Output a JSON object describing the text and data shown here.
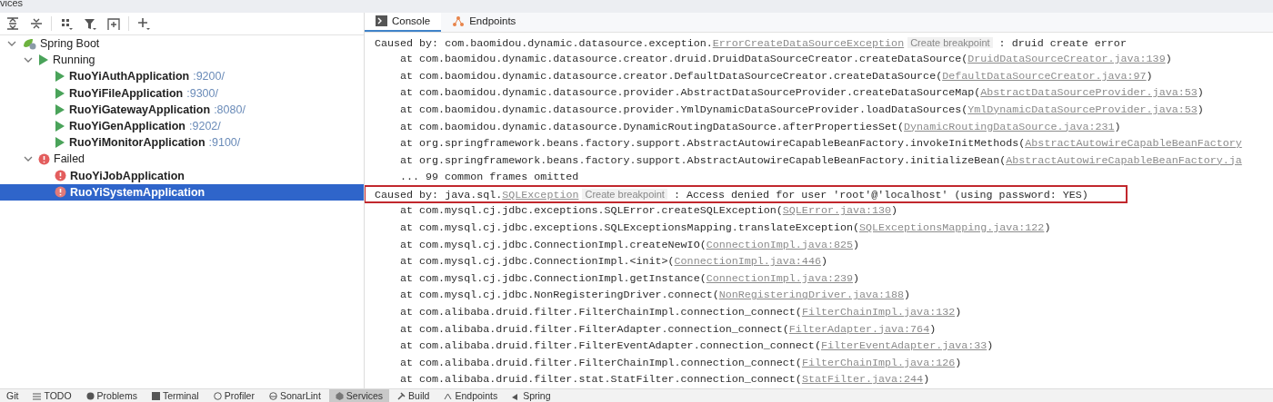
{
  "window": {
    "title": "vices"
  },
  "toolbar": {
    "buttons": [
      {
        "kind": "expand"
      },
      {
        "kind": "collapse"
      },
      {
        "kind": "group"
      },
      {
        "kind": "filter"
      },
      {
        "kind": "new-tab"
      },
      {
        "kind": "add"
      }
    ]
  },
  "tree": {
    "items": [
      {
        "label": "Spring Boot",
        "kind": "spring",
        "expanded": true,
        "selected": false,
        "children": [
          {
            "label": "Running",
            "kind": "running",
            "expanded": true,
            "selected": false,
            "children": [
              {
                "label": "RuoYiAuthApplication",
                "port": ":9200/",
                "kind": "running",
                "selected": false
              },
              {
                "label": "RuoYiFileApplication",
                "port": ":9300/",
                "kind": "running",
                "selected": false
              },
              {
                "label": "RuoYiGatewayApplication",
                "port": ":8080/",
                "kind": "running",
                "selected": false
              },
              {
                "label": "RuoYiGenApplication",
                "port": ":9202/",
                "kind": "running",
                "selected": false
              },
              {
                "label": "RuoYiMonitorApplication",
                "port": ":9100/",
                "kind": "running",
                "selected": false
              }
            ]
          },
          {
            "label": "Failed",
            "kind": "failed",
            "expanded": true,
            "selected": false,
            "children": [
              {
                "label": "RuoYiJobApplication",
                "kind": "failed",
                "selected": false
              },
              {
                "label": "RuoYiSystemApplication",
                "kind": "failed",
                "selected": true
              }
            ]
          }
        ]
      }
    ]
  },
  "tabs": [
    {
      "label": "Console",
      "kind": "console",
      "selected": true
    },
    {
      "label": "Endpoints",
      "kind": "endpoints",
      "selected": false
    }
  ],
  "console": {
    "lines": [
      {
        "kind": "cause",
        "highlighted": false,
        "parts": [
          {
            "kind": "plain",
            "text": "Caused by: com.baomidou.dynamic.datasource.exception."
          },
          {
            "kind": "link",
            "text": "ErrorCreateDataSourceException"
          },
          {
            "kind": "hint",
            "text": "Create breakpoint"
          },
          {
            "kind": "plain",
            "text": " : druid create error"
          }
        ]
      },
      {
        "kind": "frame",
        "highlighted": false,
        "parts": [
          {
            "kind": "plain",
            "text": "at com.baomidou.dynamic.datasource.creator.druid.DruidDataSourceCreator.createDataSource("
          },
          {
            "kind": "link",
            "text": "DruidDataSourceCreator.java:139"
          },
          {
            "kind": "plain",
            "text": ")"
          }
        ]
      },
      {
        "kind": "frame",
        "highlighted": false,
        "parts": [
          {
            "kind": "plain",
            "text": "at com.baomidou.dynamic.datasource.creator.DefaultDataSourceCreator.createDataSource("
          },
          {
            "kind": "link",
            "text": "DefaultDataSourceCreator.java:97"
          },
          {
            "kind": "plain",
            "text": ")"
          }
        ]
      },
      {
        "kind": "frame",
        "highlighted": false,
        "parts": [
          {
            "kind": "plain",
            "text": "at com.baomidou.dynamic.datasource.provider.AbstractDataSourceProvider.createDataSourceMap("
          },
          {
            "kind": "link",
            "text": "AbstractDataSourceProvider.java:53"
          },
          {
            "kind": "plain",
            "text": ")"
          }
        ]
      },
      {
        "kind": "frame",
        "highlighted": false,
        "parts": [
          {
            "kind": "plain",
            "text": "at com.baomidou.dynamic.datasource.provider.YmlDynamicDataSourceProvider.loadDataSources("
          },
          {
            "kind": "link",
            "text": "YmlDynamicDataSourceProvider.java:53"
          },
          {
            "kind": "plain",
            "text": ")"
          }
        ]
      },
      {
        "kind": "frame",
        "highlighted": false,
        "parts": [
          {
            "kind": "plain",
            "text": "at com.baomidou.dynamic.datasource.DynamicRoutingDataSource.afterPropertiesSet("
          },
          {
            "kind": "link",
            "text": "DynamicRoutingDataSource.java:231"
          },
          {
            "kind": "plain",
            "text": ")"
          }
        ]
      },
      {
        "kind": "frame",
        "highlighted": false,
        "parts": [
          {
            "kind": "plain",
            "text": "at org.springframework.beans.factory.support.AbstractAutowireCapableBeanFactory.invokeInitMethods("
          },
          {
            "kind": "link",
            "text": "AbstractAutowireCapableBeanFactory"
          }
        ]
      },
      {
        "kind": "frame",
        "highlighted": false,
        "parts": [
          {
            "kind": "plain",
            "text": "at org.springframework.beans.factory.support.AbstractAutowireCapableBeanFactory.initializeBean("
          },
          {
            "kind": "link",
            "text": "AbstractAutowireCapableBeanFactory.ja"
          }
        ]
      },
      {
        "kind": "frame",
        "highlighted": false,
        "parts": [
          {
            "kind": "plain",
            "text": "... 99 common frames omitted"
          }
        ]
      },
      {
        "kind": "cause",
        "highlighted": true,
        "parts": [
          {
            "kind": "plain",
            "text": "Caused by: java.sql."
          },
          {
            "kind": "link",
            "text": "SQLException"
          },
          {
            "kind": "hint",
            "text": "Create breakpoint"
          },
          {
            "kind": "plain",
            "text": " : Access denied for user 'root'@'localhost' (using password: YES)"
          }
        ]
      },
      {
        "kind": "frame",
        "highlighted": false,
        "parts": [
          {
            "kind": "plain",
            "text": "at com.mysql.cj.jdbc.exceptions.SQLError.createSQLException("
          },
          {
            "kind": "link",
            "text": "SQLError.java:130"
          },
          {
            "kind": "plain",
            "text": ")"
          }
        ]
      },
      {
        "kind": "frame",
        "highlighted": false,
        "parts": [
          {
            "kind": "plain",
            "text": "at com.mysql.cj.jdbc.exceptions.SQLExceptionsMapping.translateException("
          },
          {
            "kind": "link",
            "text": "SQLExceptionsMapping.java:122"
          },
          {
            "kind": "plain",
            "text": ")"
          }
        ]
      },
      {
        "kind": "frame",
        "highlighted": false,
        "parts": [
          {
            "kind": "plain",
            "text": "at com.mysql.cj.jdbc.ConnectionImpl.createNewIO("
          },
          {
            "kind": "link",
            "text": "ConnectionImpl.java:825"
          },
          {
            "kind": "plain",
            "text": ")"
          }
        ]
      },
      {
        "kind": "frame",
        "highlighted": false,
        "parts": [
          {
            "kind": "plain",
            "text": "at com.mysql.cj.jdbc.ConnectionImpl.<init>("
          },
          {
            "kind": "link",
            "text": "ConnectionImpl.java:446"
          },
          {
            "kind": "plain",
            "text": ")"
          }
        ]
      },
      {
        "kind": "frame",
        "highlighted": false,
        "parts": [
          {
            "kind": "plain",
            "text": "at com.mysql.cj.jdbc.ConnectionImpl.getInstance("
          },
          {
            "kind": "link",
            "text": "ConnectionImpl.java:239"
          },
          {
            "kind": "plain",
            "text": ")"
          }
        ]
      },
      {
        "kind": "frame",
        "highlighted": false,
        "parts": [
          {
            "kind": "plain",
            "text": "at com.mysql.cj.jdbc.NonRegisteringDriver.connect("
          },
          {
            "kind": "link",
            "text": "NonRegisteringDriver.java:188"
          },
          {
            "kind": "plain",
            "text": ")"
          }
        ]
      },
      {
        "kind": "frame",
        "highlighted": false,
        "parts": [
          {
            "kind": "plain",
            "text": "at com.alibaba.druid.filter.FilterChainImpl.connection_connect("
          },
          {
            "kind": "link",
            "text": "FilterChainImpl.java:132"
          },
          {
            "kind": "plain",
            "text": ")"
          }
        ]
      },
      {
        "kind": "frame",
        "highlighted": false,
        "parts": [
          {
            "kind": "plain",
            "text": "at com.alibaba.druid.filter.FilterAdapter.connection_connect("
          },
          {
            "kind": "link",
            "text": "FilterAdapter.java:764"
          },
          {
            "kind": "plain",
            "text": ")"
          }
        ]
      },
      {
        "kind": "frame",
        "highlighted": false,
        "parts": [
          {
            "kind": "plain",
            "text": "at com.alibaba.druid.filter.FilterEventAdapter.connection_connect("
          },
          {
            "kind": "link",
            "text": "FilterEventAdapter.java:33"
          },
          {
            "kind": "plain",
            "text": ")"
          }
        ]
      },
      {
        "kind": "frame",
        "highlighted": false,
        "parts": [
          {
            "kind": "plain",
            "text": "at com.alibaba.druid.filter.FilterChainImpl.connection_connect("
          },
          {
            "kind": "link",
            "text": "FilterChainImpl.java:126"
          },
          {
            "kind": "plain",
            "text": ")"
          }
        ]
      },
      {
        "kind": "frame",
        "highlighted": false,
        "parts": [
          {
            "kind": "plain",
            "text": "at com.alibaba.druid.filter.stat.StatFilter.connection_connect("
          },
          {
            "kind": "link",
            "text": "StatFilter.java:244"
          },
          {
            "kind": "plain",
            "text": ")"
          }
        ]
      }
    ]
  },
  "bottom_tabs": [
    {
      "label": "Git",
      "kind": "git",
      "selected": false
    },
    {
      "label": "TODO",
      "kind": "todo",
      "selected": false
    },
    {
      "label": "Problems",
      "kind": "problems",
      "selected": false
    },
    {
      "label": "Terminal",
      "kind": "terminal",
      "selected": false
    },
    {
      "label": "Profiler",
      "kind": "profiler",
      "selected": false
    },
    {
      "label": "SonarLint",
      "kind": "sonarlint",
      "selected": false
    },
    {
      "label": "Services",
      "kind": "services",
      "selected": true
    },
    {
      "label": "Build",
      "kind": "build",
      "selected": false
    },
    {
      "label": "Endpoints",
      "kind": "endpoints",
      "selected": false
    },
    {
      "label": "Spring",
      "kind": "spring",
      "selected": false
    }
  ]
}
